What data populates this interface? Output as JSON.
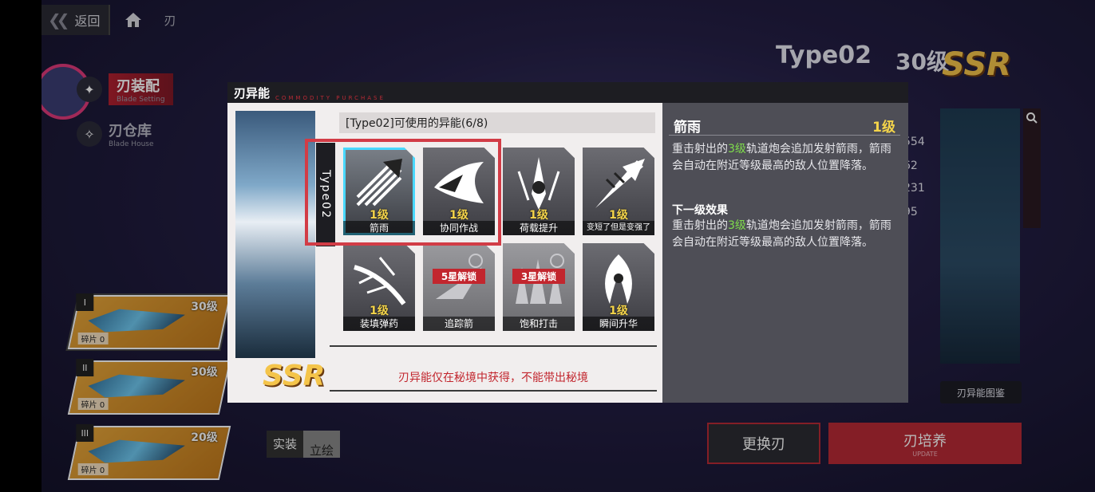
{
  "nav": {
    "back_label": "返回",
    "crumb": "刃"
  },
  "side_menu": [
    {
      "title": "刃装配",
      "sub": "Blade Setting"
    },
    {
      "title": "刃仓库",
      "sub": "Blade House"
    }
  ],
  "blades": [
    {
      "num": "I",
      "level": "30级",
      "fragments": "碎片 0"
    },
    {
      "num": "II",
      "level": "30级",
      "fragments": "碎片 0"
    },
    {
      "num": "III",
      "level": "20级",
      "fragments": "碎片 0"
    }
  ],
  "costume": {
    "a": "实装",
    "b": "立绘"
  },
  "bg_right": {
    "name": "Type02",
    "level": "30级",
    "rarity": "SSR",
    "stats": [
      "554",
      "62",
      "231",
      "95"
    ],
    "guide_btn": "刃异能图鉴",
    "change_btn": "更换刃",
    "train_btn": "刃培养",
    "train_sub": "UPDATE"
  },
  "modal": {
    "title": "刃异能",
    "subtitle": "COMMODITY PURCHASE",
    "char_tag": "Type02",
    "rarity": "SSR",
    "ability_header": "[Type02]可使用的异能(6/8)",
    "skills": [
      {
        "name": "箭雨",
        "level": "1级",
        "state": "selected"
      },
      {
        "name": "协同作战",
        "level": "1级",
        "state": "normal"
      },
      {
        "name": "荷载提升",
        "level": "1级",
        "state": "normal"
      },
      {
        "name": "变短了但是变强了",
        "level": "1级",
        "state": "normal"
      },
      {
        "name": "装填弹药",
        "level": "1级",
        "state": "normal"
      },
      {
        "name": "追踪箭",
        "level": "",
        "lock": "5星解锁",
        "state": "locked"
      },
      {
        "name": "饱和打击",
        "level": "",
        "lock": "3星解锁",
        "state": "locked"
      },
      {
        "name": "瞬间升华",
        "level": "1级",
        "state": "normal"
      }
    ],
    "note": "刃异能仅在秘境中获得，不能带出秘境",
    "detail": {
      "title": "箭雨",
      "level": "1级",
      "desc_pre": "重击射出的",
      "desc_hl": "3级",
      "desc_post": "轨道炮会追加发射箭雨，箭雨会自动在附近等级最高的敌人位置降落。",
      "next_label": "下一级效果",
      "next_pre": "重击射出的",
      "next_hl": "3级",
      "next_post": "轨道炮会追加发射箭雨，箭雨会自动在附近等级最高的敌人位置降落。"
    }
  },
  "colors": {
    "accent_red": "#b72a35",
    "highlight_cyan": "#4ad8ff",
    "level_gold": "#f4d44a",
    "desc_green": "#7fdc4c"
  }
}
